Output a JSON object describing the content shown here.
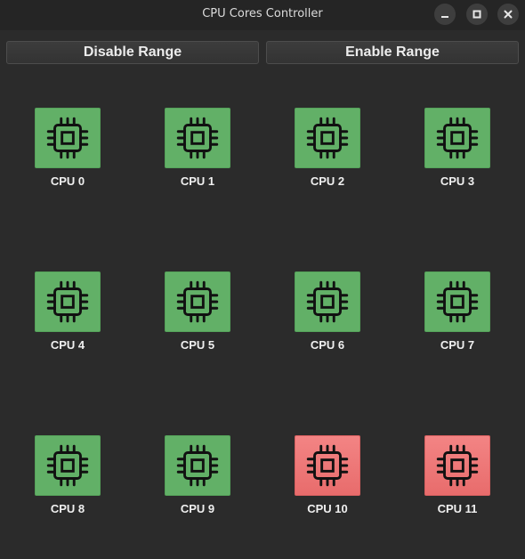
{
  "window": {
    "title": "CPU Cores Controller",
    "controls": [
      "minimize-icon",
      "maximize-icon",
      "close-icon"
    ]
  },
  "toolbar": {
    "disable_label": "Disable Range",
    "enable_label": "Enable Range"
  },
  "colors": {
    "enabled": "#62b067",
    "disabled": "#ee7777",
    "background": "#2b2b2b"
  },
  "cpus": [
    {
      "label": "CPU 0",
      "enabled": true
    },
    {
      "label": "CPU 1",
      "enabled": true
    },
    {
      "label": "CPU 2",
      "enabled": true
    },
    {
      "label": "CPU 3",
      "enabled": true
    },
    {
      "label": "CPU 4",
      "enabled": true
    },
    {
      "label": "CPU 5",
      "enabled": true
    },
    {
      "label": "CPU 6",
      "enabled": true
    },
    {
      "label": "CPU 7",
      "enabled": true
    },
    {
      "label": "CPU 8",
      "enabled": true
    },
    {
      "label": "CPU 9",
      "enabled": true
    },
    {
      "label": "CPU 10",
      "enabled": false
    },
    {
      "label": "CPU 11",
      "enabled": false
    }
  ],
  "icons": {
    "cpu": "cpu-chip-icon"
  }
}
